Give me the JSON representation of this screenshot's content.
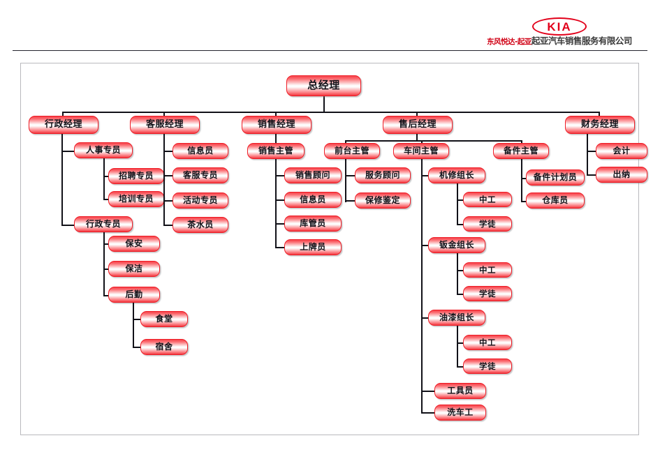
{
  "header": {
    "logo_mark": "KIA",
    "logo_text_red": "东风悦达-起亚",
    "logo_text_dark": "起亚汽车销售服务有限公司"
  },
  "chart": {
    "root": "总经理",
    "managers": {
      "admin": "行政经理",
      "service": "客服经理",
      "sales": "销售经理",
      "aftersales": "售后经理",
      "finance": "财务经理"
    },
    "admin_branch": {
      "hr": "人事专员",
      "hr_children": [
        "招聘专员",
        "培训专员"
      ],
      "affairs": "行政专员",
      "affairs_children": [
        "保安",
        "保洁",
        "后勤"
      ],
      "logistics_children": [
        "食堂",
        "宿舍"
      ]
    },
    "service_branch": {
      "children": [
        "信息员",
        "客服专员",
        "活动专员",
        "茶水员"
      ]
    },
    "sales_branch": {
      "supervisor": "销售主管",
      "children": [
        "销售顾问",
        "信息员",
        "库管员",
        "上牌员"
      ]
    },
    "aftersales_branch": {
      "front_desk": "前台主管",
      "front_desk_children": [
        "服务顾问",
        "保修鉴定"
      ],
      "workshop": "车间主管",
      "groups": [
        {
          "leader": "机修组长",
          "members": [
            "中工",
            "学徒"
          ]
        },
        {
          "leader": "钣金组长",
          "members": [
            "中工",
            "学徒"
          ]
        },
        {
          "leader": "油漆组长",
          "members": [
            "中工",
            "学徒"
          ]
        }
      ],
      "workshop_extra": [
        "工具员",
        "洗车工"
      ],
      "parts": "备件主管",
      "parts_children": [
        "备件计划员",
        "仓库员"
      ]
    },
    "finance_branch": {
      "children": [
        "会计",
        "出纳"
      ]
    }
  }
}
